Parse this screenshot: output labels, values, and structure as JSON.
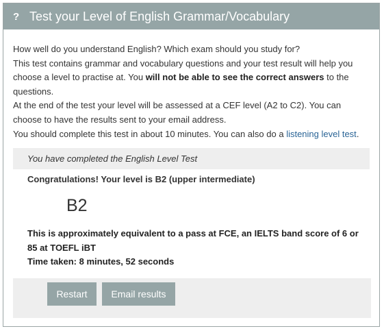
{
  "header": {
    "icon": "?",
    "title": "Test your Level of English Grammar/Vocabulary"
  },
  "intro": {
    "line1": "How well do you understand English? Which exam should you study for?",
    "line2_before": "This test contains grammar and vocabulary questions and your test result will help you choose a level to practise at. You ",
    "line2_bold": "will not be able to see the correct answers",
    "line2_after": " to the questions.",
    "line3": "At the end of the test your level will be assessed at a CEF level (A2 to C2). You can choose to have the results sent to your email address.",
    "line4_before": "You should complete this test in about 10 minutes. You can also do a ",
    "line4_link": "listening level test",
    "line4_after": "."
  },
  "result": {
    "completed": "You have completed the English Level Test",
    "congrats": "Congratulations! Your level is B2 (upper intermediate)",
    "level": "B2",
    "equivalent": "This is approximately equivalent to a pass at FCE, an IELTS band score of 6 or 85 at TOEFL iBT",
    "time_taken": "Time taken: 8 minutes, 52 seconds"
  },
  "buttons": {
    "restart": "Restart",
    "email": "Email results"
  },
  "colors": {
    "header_bg": "#95a5a6",
    "button_bg": "#95a5a6",
    "panel_bg": "#eeeeee",
    "link": "#2a6496"
  }
}
